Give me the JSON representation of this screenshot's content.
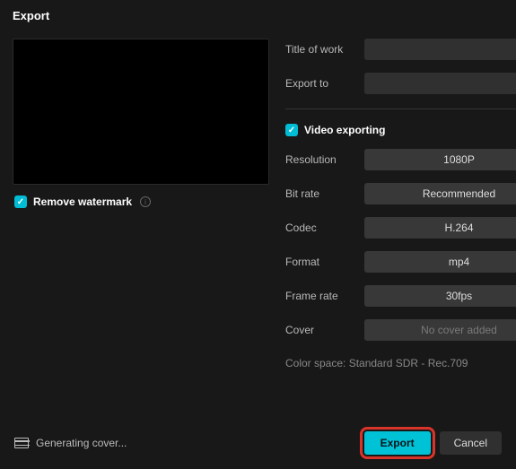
{
  "window": {
    "title": "Export"
  },
  "left": {
    "remove_watermark_label": "Remove watermark"
  },
  "fields": {
    "title_label": "Title of work",
    "title_value": "",
    "export_to_label": "Export to",
    "export_to_value": ""
  },
  "video": {
    "section_label": "Video exporting",
    "resolution_label": "Resolution",
    "resolution_value": "1080P",
    "bitrate_label": "Bit rate",
    "bitrate_value": "Recommended",
    "codec_label": "Codec",
    "codec_value": "H.264",
    "format_label": "Format",
    "format_value": "mp4",
    "framerate_label": "Frame rate",
    "framerate_value": "30fps",
    "cover_label": "Cover",
    "cover_value": "No cover added",
    "color_space": "Color space:  Standard SDR - Rec.709"
  },
  "footer": {
    "generating": "Generating cover...",
    "export": "Export",
    "cancel": "Cancel"
  }
}
